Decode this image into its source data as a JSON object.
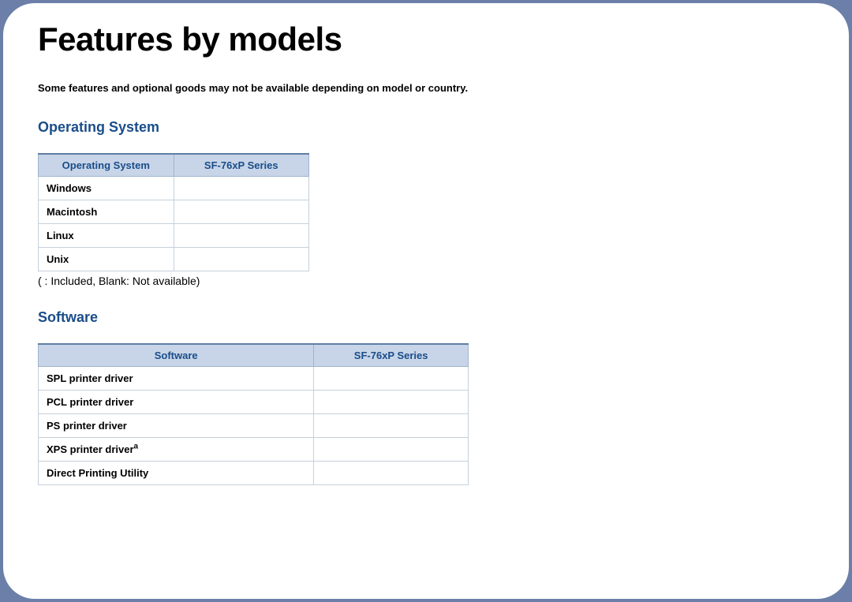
{
  "page_title": "Features by models",
  "intro_text": "Some features and optional goods may not be available depending on model or country.",
  "section_os": {
    "heading": "Operating System",
    "columns": [
      "Operating System",
      "SF-76xP Series"
    ],
    "rows": [
      {
        "label": "Windows",
        "value": ""
      },
      {
        "label": "Macintosh",
        "value": ""
      },
      {
        "label": "Linux",
        "value": ""
      },
      {
        "label": "Unix",
        "value": ""
      }
    ],
    "legend": "(   : Included, Blank: Not available)"
  },
  "section_sw": {
    "heading": "Software",
    "columns": [
      "Software",
      "SF-76xP Series"
    ],
    "rows": [
      {
        "label": "SPL printer driver",
        "sup": "",
        "value": ""
      },
      {
        "label": "PCL printer driver",
        "sup": "",
        "value": ""
      },
      {
        "label": "PS printer driver",
        "sup": "",
        "value": ""
      },
      {
        "label": "XPS printer driver",
        "sup": "a",
        "value": ""
      },
      {
        "label": "Direct Printing Utility",
        "sup": "",
        "value": ""
      }
    ]
  }
}
